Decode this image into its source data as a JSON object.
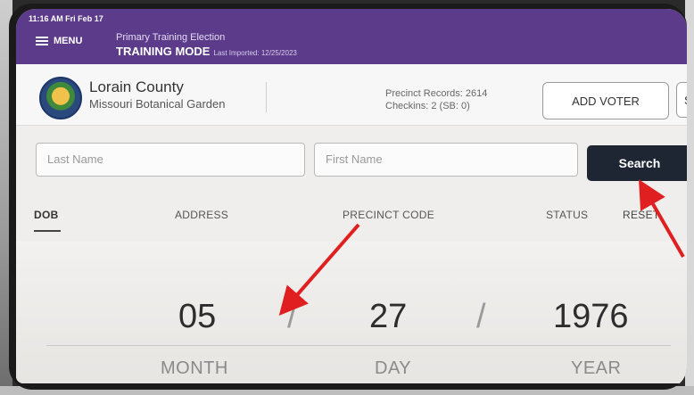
{
  "status_bar": {
    "time_date": "11:16 AM  Fri Feb 17"
  },
  "header": {
    "menu_label": "MENU",
    "election_name": "Primary Training Election",
    "mode": "TRAINING MODE",
    "last_imported": "Last Imported: 12/25/2023"
  },
  "county": {
    "name": "Lorain County",
    "location": "Missouri Botanical Garden",
    "records_line": "Precinct Records:  2614",
    "checkins_line": "Checkins:  2 (SB: 0)",
    "add_voter_label": "ADD VOTER",
    "next_button_label": "S"
  },
  "search": {
    "last_name_placeholder": "Last Name",
    "first_name_placeholder": "First Name",
    "button_label": "Search"
  },
  "tabs": [
    {
      "label": "DOB"
    },
    {
      "label": "ADDRESS"
    },
    {
      "label": "PRECINCT CODE"
    },
    {
      "label": "STATUS"
    },
    {
      "label": "RESET"
    }
  ],
  "dob": {
    "month": "05",
    "day": "27",
    "year": "1976",
    "separator": "/",
    "month_label": "MONTH",
    "day_label": "DAY",
    "year_label": "YEAR"
  },
  "colors": {
    "header_bg": "#5b3b8a",
    "search_button_bg": "#1f2633",
    "annotation_arrow": "#e02020"
  }
}
